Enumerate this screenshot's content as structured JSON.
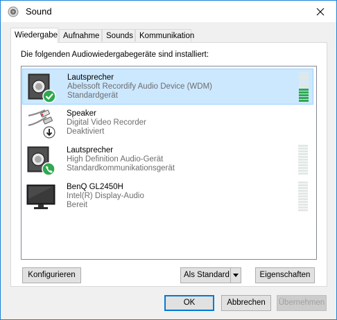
{
  "window": {
    "title": "Sound"
  },
  "tabs": [
    {
      "label": "Wiedergabe",
      "active": true
    },
    {
      "label": "Aufnahme"
    },
    {
      "label": "Sounds"
    },
    {
      "label": "Kommunikation"
    }
  ],
  "panel": {
    "heading": "Die folgenden Audiowiedergabegeräte sind installiert:"
  },
  "devices": [
    {
      "name": "Lautsprecher",
      "detail": "Abelssoft Recordify Audio Device (WDM)",
      "status": "Standardgerät",
      "icon": "speaker-icon",
      "badge": "default-check-badge",
      "selected": true,
      "level_bars_active": 5
    },
    {
      "name": "Speaker",
      "detail": "Digital Video Recorder",
      "status": "Deaktiviert",
      "icon": "rca-cable-icon",
      "badge": "disabled-arrow-badge",
      "selected": false,
      "level_bars_active": 0
    },
    {
      "name": "Lautsprecher",
      "detail": "High Definition Audio-Gerät",
      "status": "Standardkommunikationsgerät",
      "icon": "speaker-icon",
      "badge": "communication-phone-badge",
      "selected": false,
      "level_bars_active": 0
    },
    {
      "name": "BenQ GL2450H",
      "detail": "Intel(R) Display-Audio",
      "status": "Bereit",
      "icon": "monitor-icon",
      "badge": "",
      "selected": false,
      "level_bars_active": 0
    }
  ],
  "buttons": {
    "configure": "Konfigurieren",
    "set_default": "Als Standard",
    "properties": "Eigenschaften",
    "ok": "OK",
    "cancel": "Abbrechen",
    "apply": "Übernehmen"
  },
  "colors": {
    "accent": "#0078d7",
    "selection": "#cce8ff",
    "meter_active": "#2fa84f",
    "meter_idle": "#e2e8e6"
  }
}
